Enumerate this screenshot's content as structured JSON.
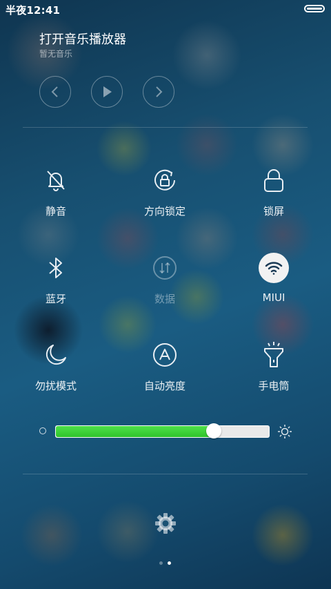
{
  "status_bar": {
    "time": "半夜12:41",
    "battery_icon": "battery-full-icon"
  },
  "music": {
    "title": "打开音乐播放器",
    "subtitle": "暂无音乐",
    "controls": [
      "previous-icon",
      "play-icon",
      "next-icon"
    ]
  },
  "toggles": [
    {
      "label": "静音",
      "icon": "bell-off-icon",
      "state": "off"
    },
    {
      "label": "方向锁定",
      "icon": "rotation-lock-icon",
      "state": "off"
    },
    {
      "label": "锁屏",
      "icon": "lock-icon",
      "state": "off"
    },
    {
      "label": "蓝牙",
      "icon": "bluetooth-icon",
      "state": "off"
    },
    {
      "label": "数据",
      "icon": "mobile-data-icon",
      "state": "disabled"
    },
    {
      "label": "MIUI",
      "icon": "wifi-icon",
      "state": "on"
    },
    {
      "label": "勿扰模式",
      "icon": "moon-icon",
      "state": "off"
    },
    {
      "label": "自动亮度",
      "icon": "auto-brightness-icon",
      "state": "off"
    },
    {
      "label": "手电筒",
      "icon": "flashlight-icon",
      "state": "off"
    }
  ],
  "brightness": {
    "level": 0.74,
    "fill_color": "#2fc42c"
  },
  "settings_icon": "gear-icon",
  "pagination": {
    "pages": 2,
    "active": 2
  }
}
